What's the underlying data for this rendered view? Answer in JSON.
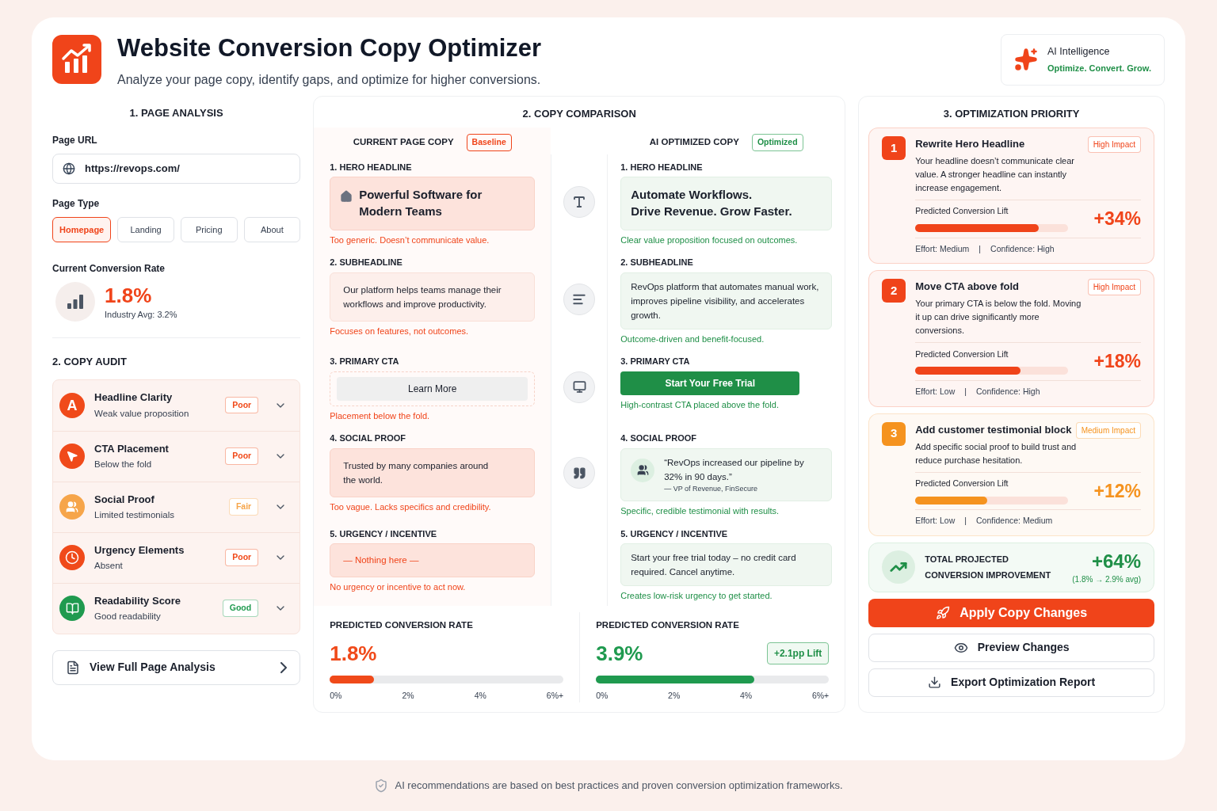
{
  "header": {
    "title": "Website Conversion Copy Optimizer",
    "subtitle": "Analyze your page copy, identify gaps, and optimize for higher conversions.",
    "badge_title": "AI Intelligence",
    "badge_tagline": "Optimize. Convert. Grow."
  },
  "page_analysis": {
    "heading": "1. PAGE ANALYSIS",
    "url_label": "Page URL",
    "url": "https://revops.com/",
    "type_label": "Page Type",
    "page_types": [
      {
        "label": "Homepage",
        "selected": true
      },
      {
        "label": "Landing",
        "selected": false
      },
      {
        "label": "Pricing",
        "selected": false
      },
      {
        "label": "About",
        "selected": false
      }
    ],
    "rate_label": "Current Conversion Rate",
    "rate": "1.8%",
    "industry_avg": "Industry Avg: 3.2%"
  },
  "copy_audit": {
    "heading": "2. COPY AUDIT",
    "items": [
      {
        "title": "Headline Clarity",
        "subtitle": "Weak value proposition",
        "rating": "Poor",
        "color": "#f04a1a",
        "letter": "A"
      },
      {
        "title": "CTA Placement",
        "subtitle": "Below the fold",
        "rating": "Poor",
        "color": "#f04a1a"
      },
      {
        "title": "Social Proof",
        "subtitle": "Limited testimonials",
        "rating": "Fair",
        "color": "#f6a54a"
      },
      {
        "title": "Urgency Elements",
        "subtitle": "Absent",
        "rating": "Poor",
        "color": "#f04a1a"
      },
      {
        "title": "Readability Score",
        "subtitle": "Good readability",
        "rating": "Good",
        "color": "#1f9a4f"
      }
    ]
  },
  "view_button": "View Full Page Analysis",
  "comparison": {
    "heading": "2. COPY COMPARISON",
    "current_heading": "CURRENT PAGE COPY",
    "current_badge": "Baseline",
    "optimized_heading": "AI OPTIMIZED COPY",
    "optimized_badge": "Optimized",
    "sections": [
      {
        "kind": "headline",
        "current": {
          "label": "1. HERO HEADLINE",
          "text": "Powerful Software for Modern Teams",
          "note": "Too generic. Doesn’t communicate value."
        },
        "optimized": {
          "label": "1. HERO HEADLINE",
          "lines": [
            "Automate Workflows.",
            "Drive Revenue. Grow Faster."
          ],
          "note": "Clear value proposition focused on outcomes."
        }
      },
      {
        "kind": "text",
        "current": {
          "label": "2. SUBHEADLINE",
          "text": "Our platform helps teams manage their workflows and improve productivity.",
          "note": "Focuses on features, not outcomes."
        },
        "optimized": {
          "label": "2. SUBHEADLINE",
          "text": "RevOps platform that automates manual work, improves pipeline visibility, and accelerates growth.",
          "note": "Outcome-driven and benefit-focused."
        }
      },
      {
        "kind": "cta",
        "current": {
          "label": "3. PRIMARY CTA",
          "text": "Learn More",
          "note": "Placement below the fold."
        },
        "optimized": {
          "label": "3. PRIMARY CTA",
          "text": "Start Your Free Trial",
          "note": "High-contrast CTA placed above the fold."
        }
      },
      {
        "kind": "quote",
        "current": {
          "label": "4. SOCIAL PROOF",
          "text": "Trusted by many companies around the world.",
          "note": "Too vague. Lacks specifics and credibility."
        },
        "optimized": {
          "label": "4. SOCIAL PROOF",
          "text": "“RevOps increased our pipeline by 32% in 90 days.”",
          "author": "— VP of Revenue, FinSecure",
          "note": "Specific, credible testimonial with results."
        }
      },
      {
        "kind": "empty",
        "current": {
          "label": "5. URGENCY / INCENTIVE",
          "text": "— Nothing here —",
          "note": "No urgency or incentive to act now."
        },
        "optimized": {
          "label": "5. URGENCY / INCENTIVE",
          "text": "Start your free trial today – no credit card required. Cancel anytime.",
          "note": "Creates low-risk urgency to get started."
        }
      }
    ],
    "predictions": [
      {
        "label": "PREDICTED CONVERSION RATE",
        "value": "1.8%",
        "level": 0.19,
        "color": "#f04a1a",
        "ticks": [
          "0%",
          "2%",
          "4%",
          "6%+"
        ]
      },
      {
        "label": "PREDICTED CONVERSION RATE",
        "value": "3.9%",
        "level": 0.68,
        "color": "#1f9a4f",
        "ticks": [
          "0%",
          "2%",
          "4%",
          "6%+"
        ],
        "lift": "+2.1pp Lift"
      }
    ]
  },
  "priority": {
    "heading": "3. OPTIMIZATION PRIORITY",
    "items": [
      {
        "rank": "1",
        "title": "Rewrite Hero Headline",
        "impact": "High Impact",
        "color": "#f0441a",
        "description": "Your headline doesn’t communicate clear value. A stronger headline can instantly increase engagement.",
        "lift_label": "Predicted Conversion Lift",
        "lift": "+34%",
        "level": 0.81,
        "meta": [
          "Effort: Medium",
          "|",
          "Confidence: High"
        ]
      },
      {
        "rank": "2",
        "title": "Move CTA above fold",
        "impact": "High Impact",
        "color": "#f0441a",
        "description": "Your primary CTA is below the fold. Moving it up can drive significantly more conversions.",
        "lift_label": "Predicted Conversion Lift",
        "lift": "+18%",
        "level": 0.69,
        "meta": [
          "Effort: Low",
          "|",
          "Confidence: High"
        ]
      },
      {
        "rank": "3",
        "title": "Add customer testimonial block",
        "impact": "Medium Impact",
        "color": "#f5931f",
        "description": "Add specific social proof to build trust and reduce purchase hesitation.",
        "lift_label": "Predicted Conversion Lift",
        "lift": "+12%",
        "level": 0.47,
        "meta": [
          "Effort: Low",
          "|",
          "Confidence: Medium"
        ]
      }
    ],
    "total_label": "TOTAL PROJECTED CONVERSION IMPROVEMENT",
    "total": "+64%",
    "total_detail": "(1.8% → 2.9% avg)"
  },
  "actions": [
    {
      "label": "Apply Copy Changes",
      "kind": "primary"
    },
    {
      "label": "Preview Changes",
      "kind": "secondary"
    },
    {
      "label": "Export Optimization Report",
      "kind": "secondary"
    }
  ],
  "footer": "AI recommendations are based on best practices and proven conversion optimization frameworks."
}
